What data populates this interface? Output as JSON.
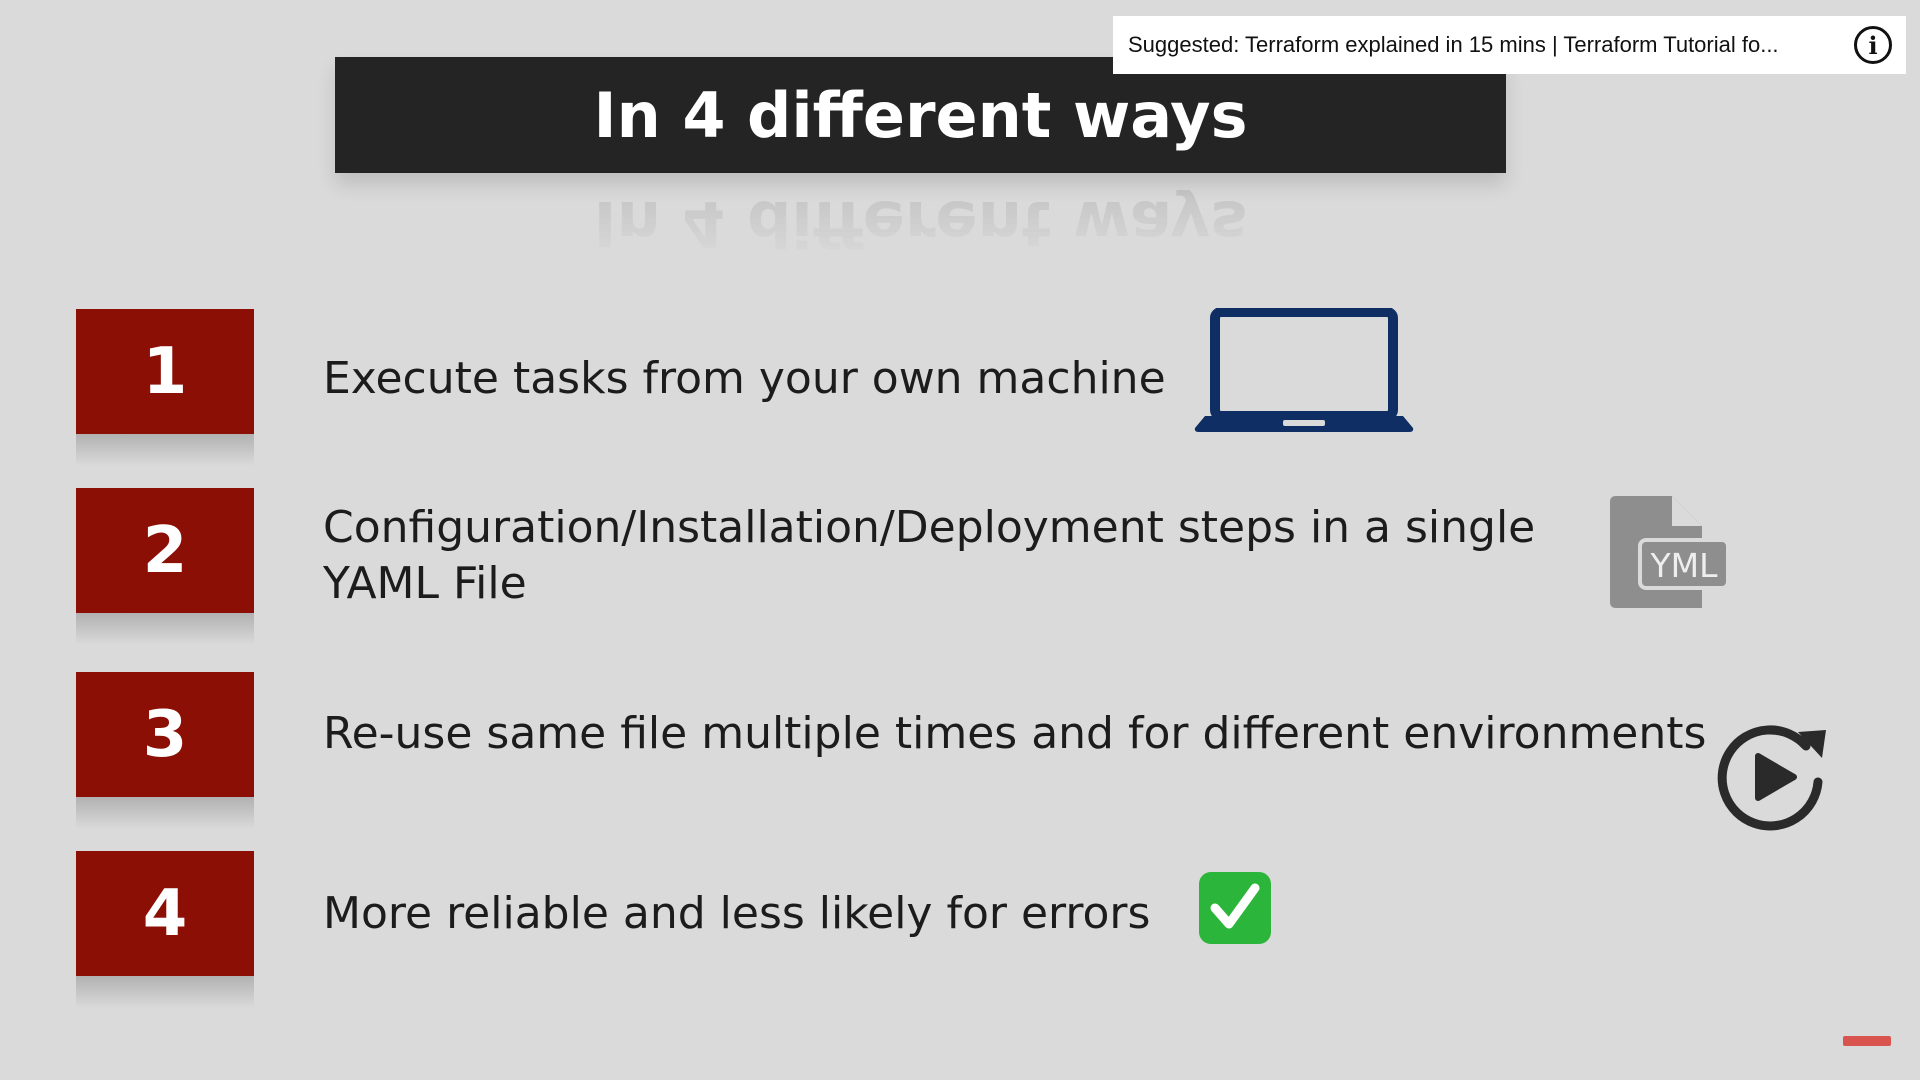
{
  "title": "In 4 different ways",
  "suggestion": {
    "text": "Suggested: Terraform explained in 15 mins | Terraform Tutorial fo...",
    "info_icon": "info-icon",
    "info_glyph": "i"
  },
  "steps": [
    {
      "number": "1",
      "lines": [
        "Execute tasks from your own machine"
      ],
      "icon": "laptop-icon"
    },
    {
      "number": "2",
      "lines": [
        "Configuration/Installation/Deployment steps in a single",
        "YAML File"
      ],
      "icon": "yml-file-icon"
    },
    {
      "number": "3",
      "lines": [
        "Re-use same file multiple times and for different environments"
      ],
      "icon": "replay-icon"
    },
    {
      "number": "4",
      "lines": [
        "More reliable and less likely for errors"
      ],
      "icon": "check-mark-icon"
    }
  ],
  "yml_label": "YML",
  "colors": {
    "number_box": "#8b0f05",
    "title_bar": "#242424",
    "laptop": "#0f2e63",
    "check_green": "#2bb53a",
    "file_icon": "#8e8e8e"
  }
}
